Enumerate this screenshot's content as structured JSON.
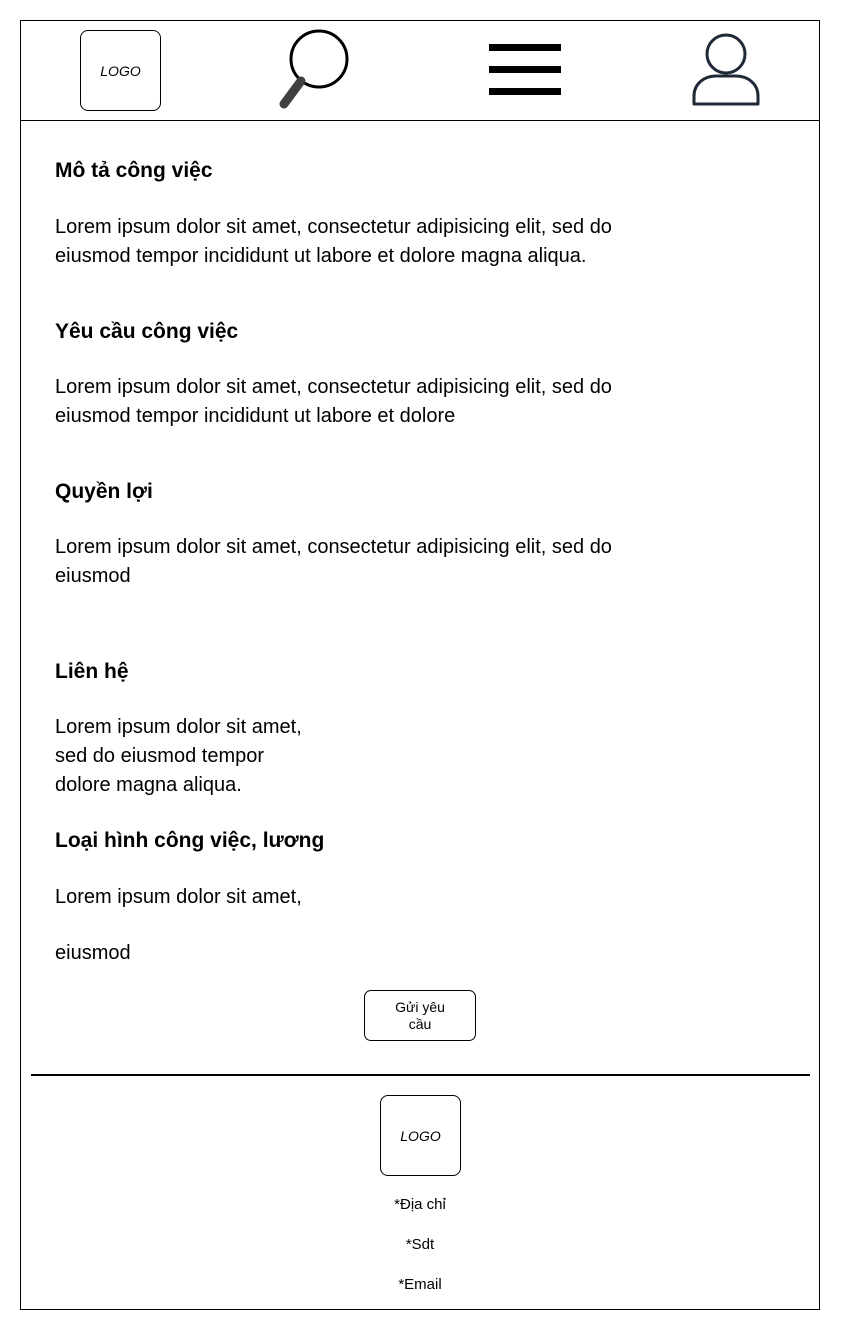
{
  "header": {
    "logo_text": "LOGO",
    "icons": [
      "search-icon",
      "menu-icon",
      "user-icon"
    ]
  },
  "sections": [
    {
      "title": "Mô  tả công việc",
      "text": "Lorem ipsum dolor sit amet, consectetur adipisicing elit, sed do\neiusmod tempor incididunt ut labore et dolore magna aliqua."
    },
    {
      "title": "Yêu cầu công việc",
      "text": "Lorem ipsum dolor sit amet, consectetur adipisicing elit, sed do\neiusmod tempor incididunt ut labore et dolore"
    },
    {
      "title": "Quyền lợi",
      "text": "Lorem ipsum dolor sit amet, consectetur adipisicing elit, sed do\neiusmod"
    },
    {
      "title": "Liên hệ",
      "text": "Lorem ipsum dolor sit amet,\nsed do eiusmod tempor\n dolore magna aliqua."
    },
    {
      "title": "Loại hình công việc, lương",
      "text": "Lorem ipsum dolor sit amet,",
      "text2": " eiusmod"
    }
  ],
  "submit_button": {
    "label": "Gửi yêu cầu"
  },
  "footer": {
    "logo_text": "LOGO",
    "address": "*Địa chỉ",
    "phone": "*Sdt",
    "email": "*Email"
  },
  "colors": {
    "border": "#000000",
    "magnifier_handle": "#404040",
    "user_icon_stroke": "#1f2937"
  }
}
